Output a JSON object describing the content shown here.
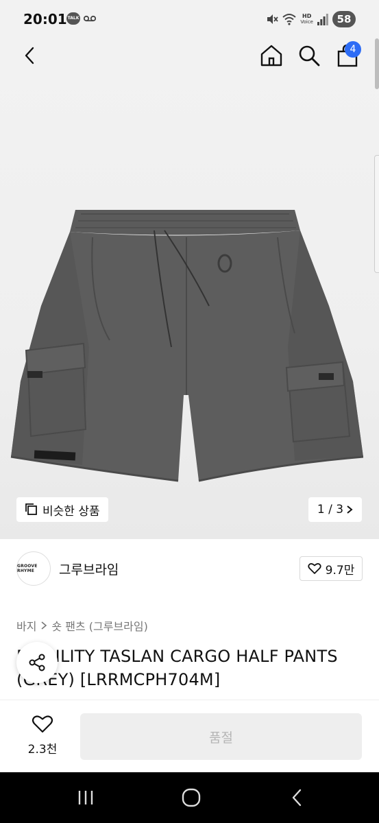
{
  "status_bar": {
    "time": "20:01",
    "talk_badge": "TALK",
    "hd_label": "HD",
    "voice_label": "Voice",
    "battery": "58"
  },
  "header": {
    "back_icon": "chevron-left-icon",
    "home_icon": "home-icon",
    "search_icon": "search-icon",
    "cart_icon": "shopping-bag-icon",
    "cart_count": "4"
  },
  "gallery": {
    "similar_label": "비슷한 상품",
    "counter": "1 / 3",
    "product_color": "#5a5a5a"
  },
  "brand": {
    "logo_text": "GROOVE RHYME",
    "name": "그루브라임",
    "likes": "9.7만"
  },
  "breadcrumb": {
    "items": [
      "바지",
      "숏 팬츠 (그루브라임)"
    ]
  },
  "product": {
    "title_line1": "MOBILITY TASLAN CARGO HALF PANTS",
    "title_line2": "(GREY) [LRRMCPH704M]"
  },
  "action_bar": {
    "wish_count": "2.3천",
    "buy_label": "품절"
  },
  "colors": {
    "accent": "#2d6cf5",
    "disabled_bg": "#eeeeee",
    "disabled_text": "#b5b5b5"
  }
}
